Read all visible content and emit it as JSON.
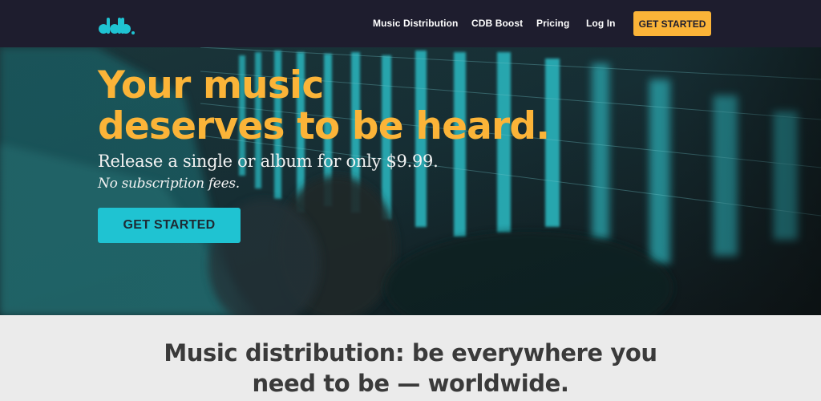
{
  "nav": {
    "logo_icon": "cdbaby-logo-icon",
    "links": [
      {
        "label": "Music Distribution"
      },
      {
        "label": "CDB Boost"
      },
      {
        "label": "Pricing"
      },
      {
        "label": "Log In"
      }
    ],
    "cta_label": "GET STARTED"
  },
  "hero": {
    "headline_line1": "Your music",
    "headline_line2": "deserves to be heard.",
    "subline": "Release a single or album for only $9.99.",
    "note": "No subscription fees.",
    "cta_label": "GET STARTED",
    "background_image": "guitar-neck-closeup-image"
  },
  "section": {
    "title_line1": "Music distribution: be everywhere you",
    "title_line2": "need to be — worldwide."
  },
  "colors": {
    "nav_bg": "#1e1d2e",
    "accent_yellow": "#fbb438",
    "accent_teal": "#1fc3d2",
    "section_bg": "#ebebeb"
  }
}
